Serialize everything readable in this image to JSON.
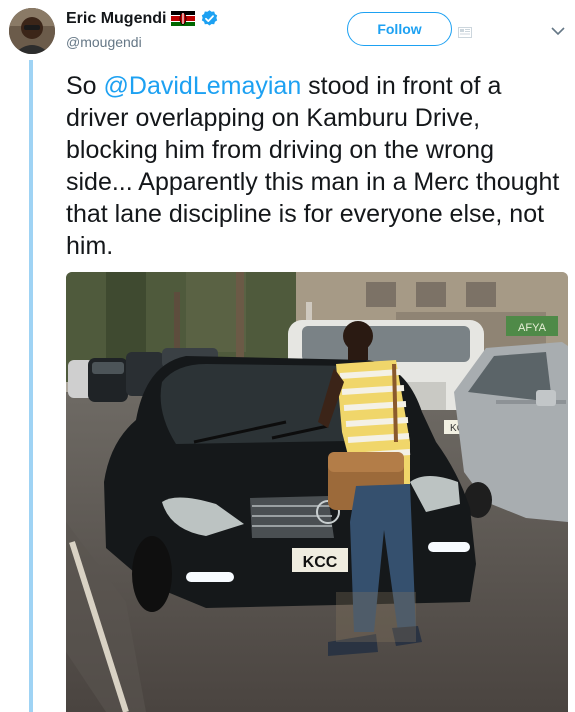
{
  "user": {
    "display_name": "Eric Mugendi",
    "handle": "@mougendi",
    "flag_icon": "kenya-flag-icon",
    "verified_icon": "verified-badge-icon"
  },
  "actions": {
    "follow_label": "Follow"
  },
  "tweet": {
    "text_prefix": "So ",
    "mention": "@DavidLemayian",
    "text_suffix": " stood in front of a driver overlapping on Kamburu Drive, blocking him from driving on the wrong side... Apparently this man in a Merc thought that lane discipline is for everyone else, not him."
  },
  "photo": {
    "plate_text": "KCC",
    "plate_text_2": "KC",
    "sign_text": "AFYA"
  },
  "colors": {
    "accent": "#1da1f2",
    "thread_line": "#9fd3f4",
    "text": "#14171a",
    "muted": "#657786"
  }
}
